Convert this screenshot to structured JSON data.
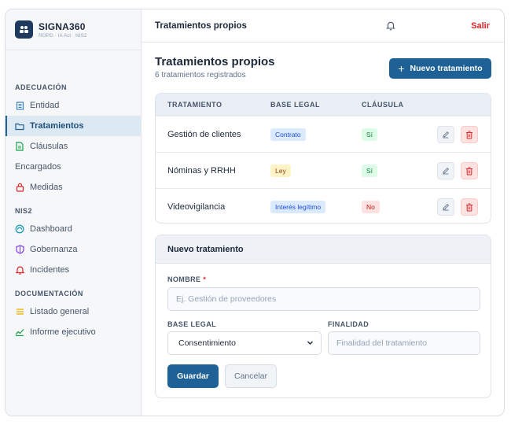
{
  "brand": {
    "name": "SIGNA360",
    "subtitle": "RGPD · IA Act · NIS2"
  },
  "sidebar": {
    "sections": [
      {
        "title": "ADECUACIÓN",
        "items": [
          {
            "label": "Entidad",
            "icon": "building-icon"
          },
          {
            "label": "Tratamientos",
            "icon": "folder-icon",
            "active": true
          },
          {
            "label": "Cláusulas",
            "icon": "document-icon"
          },
          {
            "label": "Encargados",
            "icon": ""
          },
          {
            "label": "Medidas",
            "icon": "lock-icon"
          }
        ]
      },
      {
        "title": "NIS2",
        "items": [
          {
            "label": "Dashboard",
            "icon": "dashboard-icon"
          },
          {
            "label": "Gobernanza",
            "icon": "shield-icon"
          },
          {
            "label": "Incidentes",
            "icon": "bell-icon"
          }
        ]
      },
      {
        "title": "DOCUMENTACIÓN",
        "items": [
          {
            "label": "Listado general",
            "icon": "list-icon"
          },
          {
            "label": "Informe ejecutivo",
            "icon": "chart-icon"
          }
        ]
      }
    ]
  },
  "topbar": {
    "title": "Tratamientos propios",
    "logout": "Salir"
  },
  "page": {
    "title": "Tratamientos propios",
    "subtitle": "6 tratamientos registrados",
    "new_button": "Nuevo tratamiento"
  },
  "table": {
    "columns": [
      "TRATAMIENTO",
      "BASE LEGAL",
      "CLÁUSULA"
    ],
    "rows": [
      {
        "name": "Gestión de clientes",
        "legal_basis": "Contrato",
        "legal_color": "blue",
        "clause": "Sí",
        "clause_color": "green"
      },
      {
        "name": "Nóminas y RRHH",
        "legal_basis": "Ley",
        "legal_color": "yellow",
        "clause": "Sí",
        "clause_color": "green"
      },
      {
        "name": "Videovigilancia",
        "legal_basis": "Interés legítimo",
        "legal_color": "blue",
        "clause": "No",
        "clause_color": "red"
      }
    ]
  },
  "form": {
    "title": "Nuevo tratamiento",
    "name_label": "NOMBRE",
    "name_required_mark": "*",
    "name_placeholder": "Ej. Gestión de proveedores",
    "legal_label": "BASE LEGAL",
    "legal_value": "Consentimiento",
    "purpose_label": "FINALIDAD",
    "purpose_placeholder": "Finalidad del tratamiento",
    "save": "Guardar",
    "cancel": "Cancelar"
  },
  "colors": {
    "primary": "#1e6196",
    "danger": "#dc2626",
    "brand_dark": "#1e3a5f"
  }
}
